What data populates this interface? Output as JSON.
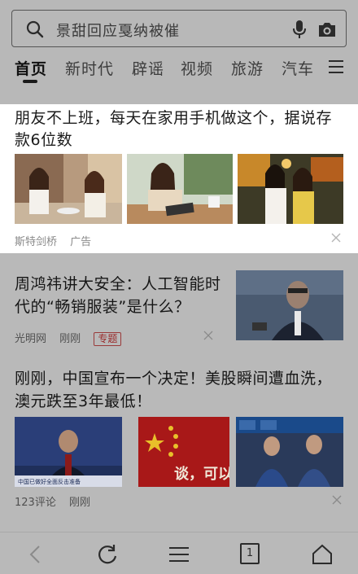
{
  "search": {
    "query": "景甜回应戛纳被催"
  },
  "tabs": [
    {
      "label": "首页"
    },
    {
      "label": "新时代"
    },
    {
      "label": "辟谣"
    },
    {
      "label": "视频"
    },
    {
      "label": "旅游"
    },
    {
      "label": "汽车"
    }
  ],
  "ad": {
    "title": "朋友不上班，每天在家用手机做这个，据说存款6位数",
    "source": "斯特剑桥",
    "label": "广告"
  },
  "articles": [
    {
      "title": "周鸿祎讲大安全：人工智能时代的“畅销服装”是什么？",
      "source": "光明网",
      "time": "刚刚",
      "tag": "专题"
    },
    {
      "title": "刚刚，中国宣布一个决定！美股瞬间遭血洗，澳元跌至3年最低！",
      "comments": "123评论",
      "time": "刚刚",
      "image_caption": "中国已做好全面反击准备",
      "image2_text": "谈，可以！"
    }
  ],
  "toolbar": {
    "tab_count": "1"
  }
}
